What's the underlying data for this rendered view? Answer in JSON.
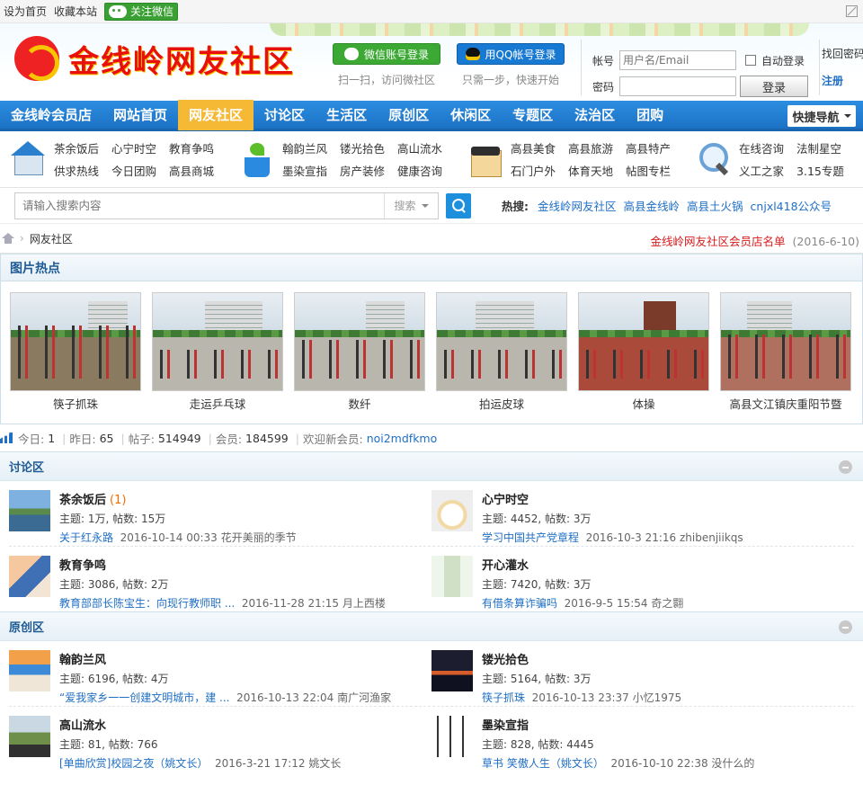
{
  "topbar": {
    "set_home": "设为首页",
    "bookmark": "收藏本站",
    "follow_wechat": "关注微信"
  },
  "header": {
    "logo_text": "金线岭网友社区",
    "wechat_login": "微信账号登录",
    "wechat_sub": "扫一扫，访问微社区",
    "qq_login": "用QQ帐号登录",
    "qq_sub": "只需一步，快速开始",
    "account_label": "帐号",
    "account_placeholder": "用户名/Email",
    "password_label": "密码",
    "auto_login": "自动登录",
    "login_button": "登录",
    "forgot_password": "找回密码",
    "register": "注册"
  },
  "nav": {
    "items": [
      "金线岭会员店",
      "网站首页",
      "网友社区",
      "讨论区",
      "生活区",
      "原创区",
      "休闲区",
      "专题区",
      "法治区",
      "团购"
    ],
    "active": "网友社区",
    "quick_nav": "快捷导航"
  },
  "categories": [
    {
      "icon": "house-icon",
      "links": [
        "茶余饭后",
        "心宁时空",
        "教育争鸣",
        "供求热线",
        "今日团购",
        "高县商城"
      ]
    },
    {
      "icon": "plant-pot-icon",
      "links": [
        "翰韵兰风",
        "镂光拾色",
        "高山流水",
        "墨染宣指",
        "房产装修",
        "健康咨询"
      ]
    },
    {
      "icon": "box-icon",
      "links": [
        "高县美食",
        "高县旅游",
        "高县特产",
        "石门户外",
        "体育天地",
        "帖图专栏"
      ]
    },
    {
      "icon": "magnifier-icon",
      "links": [
        "在线咨询",
        "法制星空",
        "义工之家",
        "3.15专题"
      ]
    }
  ],
  "search": {
    "placeholder": "请输入搜索内容",
    "type": "搜索",
    "hot_label": "热搜:",
    "hot": [
      "金线岭网友社区",
      "高县金线岭",
      "高县土火锅",
      "cnjxl418公众号"
    ]
  },
  "breadcrumb": {
    "current": "网友社区",
    "notice": "金线岭网友社区会员店名单",
    "notice_date": "(2016-6-10)"
  },
  "pictures": {
    "title": "图片热点",
    "items": [
      "筷子抓珠",
      "走运乒乓球",
      "数纤",
      "拍运皮球",
      "体操",
      "高县文江镇庆重阳节暨"
    ]
  },
  "stats": {
    "today_label": "今日:",
    "today": "1",
    "yesterday_label": "昨日:",
    "yesterday": "65",
    "posts_label": "帖子:",
    "posts": "514949",
    "members_label": "会员:",
    "members": "184599",
    "welcome_label": "欢迎新会员:",
    "newest": "noi2mdfkmo"
  },
  "sections": [
    {
      "title": "讨论区",
      "forums": [
        {
          "name": "茶余饭后",
          "new": "(1)",
          "stats": "主题: 1万, 帖数: 15万",
          "last_title": "关于红永路",
          "last_info": "2016-10-14 00:33 花开美丽的季节"
        },
        {
          "name": "心宁时空",
          "new": "",
          "stats": "主题: 4452, 帖数: 3万",
          "last_title": "学习中国共产党章程",
          "last_info": "2016-10-3 21:16 zhibenjiikqs"
        },
        {
          "name": "教育争鸣",
          "new": "",
          "stats": "主题: 3086, 帖数: 2万",
          "last_title": "教育部部长陈宝生：向现行教师职 ...",
          "last_info": "2016-11-28 21:15 月上西楼"
        },
        {
          "name": "开心灌水",
          "new": "",
          "stats": "主题: 7420, 帖数: 3万",
          "last_title": "有借条算诈骗吗",
          "last_info": "2016-9-5 15:54 奇之翾"
        }
      ]
    },
    {
      "title": "原创区",
      "forums": [
        {
          "name": "翰韵兰风",
          "new": "",
          "stats": "主题: 6196, 帖数: 4万",
          "last_title": "“爱我家乡一一创建文明城市，建 ...",
          "last_info": "2016-10-13 22:04 南广河渔家"
        },
        {
          "name": "镂光拾色",
          "new": "",
          "stats": "主题: 5164, 帖数: 3万",
          "last_title": "筷子抓珠",
          "last_info": "2016-10-13 23:37 小忆1975"
        },
        {
          "name": "高山流水",
          "new": "",
          "stats": "主题: 81, 帖数: 766",
          "last_title": "[单曲欣赏]校园之夜（姚文长）",
          "last_info": "2016-3-21 17:12 姚文长"
        },
        {
          "name": "墨染宣指",
          "new": "",
          "stats": "主题: 828, 帖数: 4445",
          "last_title": "草书 笑傲人生（姚文长）",
          "last_info": "2016-10-10 22:38 没什么的"
        }
      ]
    }
  ]
}
